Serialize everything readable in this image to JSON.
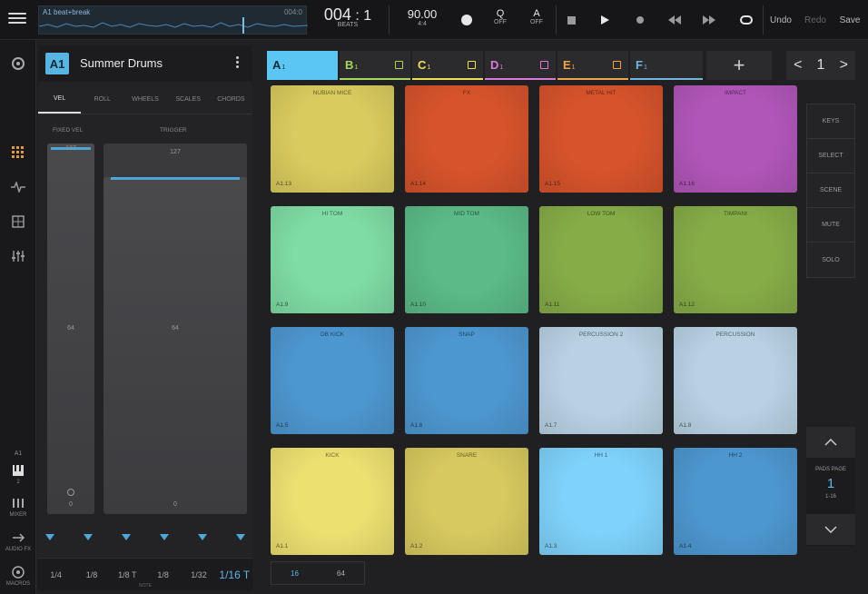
{
  "transport": {
    "track_label": "A1 beat+break",
    "loop_end": "004:0",
    "position_bar": "004",
    "position_beat": ": 1",
    "position_unit": "BEATS",
    "tempo": "90.00",
    "time_sig": "4:4",
    "quantize_label": "Q",
    "quantize_value": "OFF",
    "automation_label": "A",
    "automation_value": "OFF",
    "undo": "Undo",
    "redo": "Redo",
    "save": "Save"
  },
  "rail": {
    "bottom_track": "A1",
    "bottom_num": "2",
    "mixer_label": "MIXER",
    "audio_label": "AUDIO FX",
    "rec_label": "MACROS"
  },
  "instrument": {
    "badge": "A1",
    "name": "Summer Drums",
    "tabs": [
      "VEL",
      "ROLL",
      "WHEELS",
      "SCALES",
      "CHORDS"
    ],
    "active_tab": 0,
    "fixed_vel_label": "FIXED VEL",
    "trigger_label": "TRIGGER",
    "fixed_vel_top": "127",
    "fixed_vel_mid": "64",
    "fixed_vel_bottom": "0",
    "trigger_top": "127",
    "trigger_mid": "64",
    "trigger_bottom": "0",
    "fixed_vel_level": 1.0,
    "trigger_level": 0.91,
    "rates": [
      "1/4",
      "1/8",
      "1/8 T",
      "1/8",
      "1/32",
      "1/16 T"
    ],
    "active_rate": 5,
    "rates_footer": "NOTE"
  },
  "banks": [
    {
      "letter": "A",
      "sub": "1",
      "color": "#5cc6f2",
      "active": true
    },
    {
      "letter": "B",
      "sub": "1",
      "color": "#a7d65a",
      "active": false
    },
    {
      "letter": "C",
      "sub": "1",
      "color": "#f0de5a",
      "active": false
    },
    {
      "letter": "D",
      "sub": "1",
      "color": "#d97ad8",
      "active": false
    },
    {
      "letter": "E",
      "sub": "1",
      "color": "#f0a54a",
      "active": false
    },
    {
      "letter": "F",
      "sub": "1",
      "color": "#6fb8e4",
      "active": false
    }
  ],
  "pager": {
    "prev": "<",
    "value": "1",
    "next": ">"
  },
  "pads": [
    {
      "name": "Nubian Mice",
      "id": "A1.13",
      "color": "#d9cb5e"
    },
    {
      "name": "FX",
      "id": "A1.14",
      "color": "#d6532b"
    },
    {
      "name": "METAL HIT",
      "id": "A1.15",
      "color": "#d6532b"
    },
    {
      "name": "IMPACT",
      "id": "A1.16",
      "color": "#b156b9"
    },
    {
      "name": "HI TOM",
      "id": "A1.9",
      "color": "#7fdca4"
    },
    {
      "name": "MID TOM",
      "id": "A1.10",
      "color": "#5bba87"
    },
    {
      "name": "LOW TOM",
      "id": "A1.11",
      "color": "#86ac48"
    },
    {
      "name": "TIMPANI",
      "id": "A1.12",
      "color": "#86ac48"
    },
    {
      "name": "DB KICK",
      "id": "A1.5",
      "color": "#4d97d0"
    },
    {
      "name": "SNAP",
      "id": "A1.6",
      "color": "#4d97d0"
    },
    {
      "name": "PERCUSSION 2",
      "id": "A1.7",
      "color": "#b8d2e4"
    },
    {
      "name": "PERCUSSION",
      "id": "A1.8",
      "color": "#b8d2e4"
    },
    {
      "name": "KICK",
      "id": "A1.1",
      "color": "#ece071"
    },
    {
      "name": "SNARE",
      "id": "A1.2",
      "color": "#d7c95f"
    },
    {
      "name": "HH 1",
      "id": "A1.3",
      "color": "#7fd2fb"
    },
    {
      "name": "HH 2",
      "id": "A1.4",
      "color": "#4d97d0"
    }
  ],
  "side_buttons": [
    "KEYS",
    "SELECT",
    "SCENE",
    "MUTE",
    "SOLO"
  ],
  "pad_page": {
    "label": "PADS PAGE",
    "value": "1",
    "range": "1-16"
  },
  "bottom_pages": [
    "16",
    "64"
  ],
  "bottom_active": 0
}
